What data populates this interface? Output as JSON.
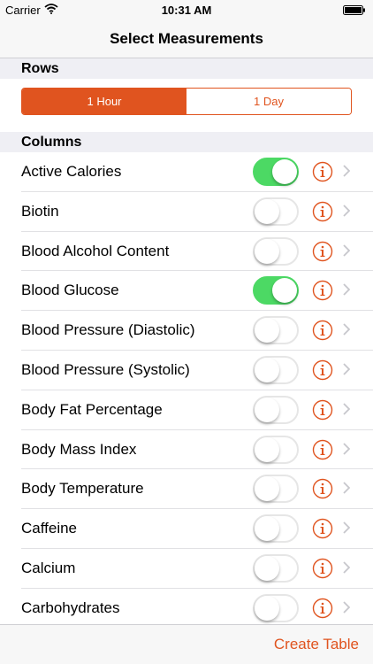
{
  "status": {
    "carrier": "Carrier",
    "time": "10:31 AM"
  },
  "nav": {
    "title": "Select Measurements"
  },
  "rows_section": {
    "title": "Rows",
    "segments": [
      "1 Hour",
      "1 Day"
    ],
    "selected_index": 0
  },
  "columns_section": {
    "title": "Columns"
  },
  "items": [
    {
      "label": "Active Calories",
      "on": true
    },
    {
      "label": "Biotin",
      "on": false
    },
    {
      "label": "Blood Alcohol Content",
      "on": false
    },
    {
      "label": "Blood Glucose",
      "on": true
    },
    {
      "label": "Blood Pressure (Diastolic)",
      "on": false
    },
    {
      "label": "Blood Pressure (Systolic)",
      "on": false
    },
    {
      "label": "Body Fat Percentage",
      "on": false
    },
    {
      "label": "Body Mass Index",
      "on": false
    },
    {
      "label": "Body Temperature",
      "on": false
    },
    {
      "label": "Caffeine",
      "on": false
    },
    {
      "label": "Calcium",
      "on": false
    },
    {
      "label": "Carbohydrates",
      "on": false
    }
  ],
  "footer": {
    "create_label": "Create Table"
  },
  "colors": {
    "accent": "#e0541f",
    "toggle_on": "#4cd964"
  },
  "icons": {
    "info": "info-icon",
    "chevron": "chevron-right-icon",
    "wifi": "wifi-icon",
    "battery": "battery-icon"
  }
}
